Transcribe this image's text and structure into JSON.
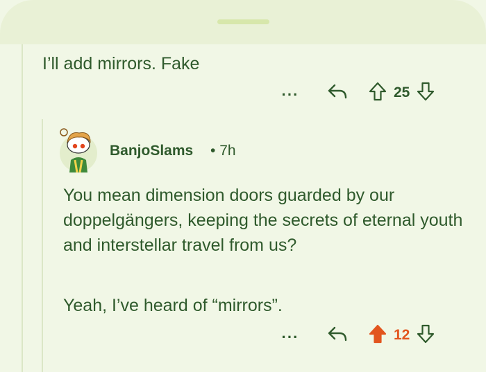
{
  "parent_comment": {
    "text": "I’ll add mirrors. Fake",
    "actions": {
      "more_icon": "more-dots-icon",
      "reply_icon": "reply-arrow-icon",
      "upvote_icon": "upvote-arrow-icon",
      "downvote_icon": "downvote-arrow-icon",
      "more_label": "···",
      "score": "25"
    }
  },
  "reply_comment": {
    "author": "BanjoSlams",
    "separator": "•",
    "age": "7h",
    "avatar_icon": "snoo-avatar-icon",
    "paragraph_1": "You mean dimension doors guarded by our doppelgängers, keeping the secrets of eternal youth and interstellar travel from us?",
    "paragraph_2": "Yeah, I’ve heard of “mirrors”.",
    "actions": {
      "more_icon": "more-dots-icon",
      "reply_icon": "reply-arrow-icon",
      "upvote_icon": "upvote-arrow-filled-icon",
      "downvote_icon": "downvote-arrow-icon",
      "more_label": "···",
      "score": "12",
      "upvoted": true
    }
  },
  "colors": {
    "background": "#f1f7e6",
    "header_sheet": "#e9f1d6",
    "text": "#2f5a2c",
    "upvote_active": "#e2551e",
    "thread_line": "#dbe7c6"
  }
}
